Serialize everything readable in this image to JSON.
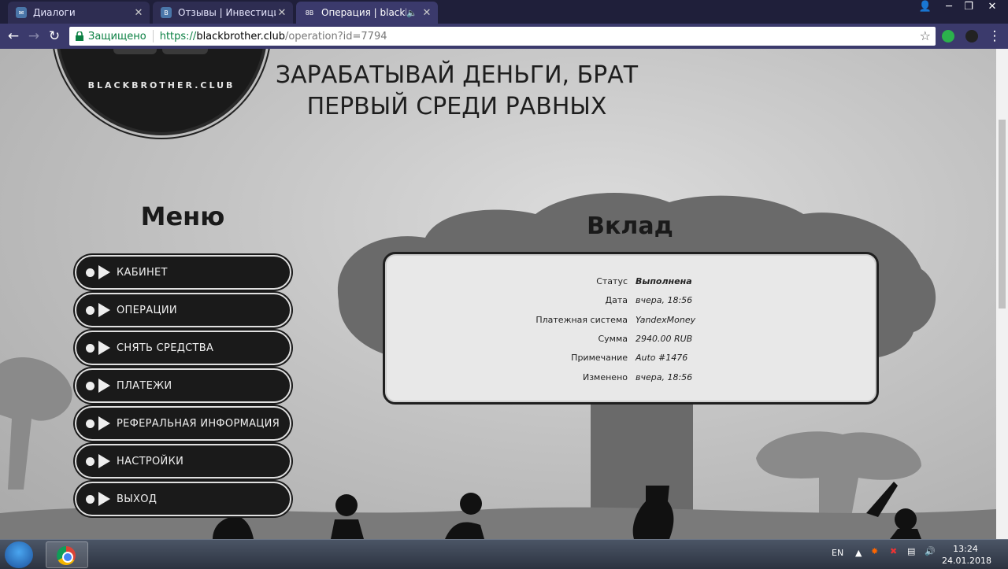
{
  "tabs": [
    {
      "title": "Диалоги",
      "active": false
    },
    {
      "title": "Отзывы | Инвестиционн",
      "active": false
    },
    {
      "title": "Операция | blackbrot",
      "active": true
    }
  ],
  "tab_favicon_text": "8B",
  "address": {
    "secure_label": "Защищено",
    "scheme": "https://",
    "host": "blackbrother.club",
    "path": "/operation?id=7794"
  },
  "site": {
    "logo_text": "BLACKBROTHER.CLUB",
    "slogan_line1": "ЗАРАБАТЫВАЙ ДЕНЬГИ, БРАТ",
    "slogan_line2": "ПЕРВЫЙ СРЕДИ РАВНЫХ"
  },
  "menu": {
    "title": "Меню",
    "items": [
      {
        "label": "КАБИНЕТ"
      },
      {
        "label": "ОПЕРАЦИИ"
      },
      {
        "label": "СНЯТЬ СРЕДСТВА"
      },
      {
        "label": "ПЛАТЕЖИ"
      },
      {
        "label": "РЕФЕРАЛЬНАЯ ИНФОРМАЦИЯ"
      },
      {
        "label": "НАСТРОЙКИ"
      },
      {
        "label": "ВЫХОД"
      }
    ]
  },
  "deposit": {
    "title": "Вклад",
    "rows": [
      {
        "key": "Статус",
        "value": "Выполнена"
      },
      {
        "key": "Дата",
        "value": "вчера, 18:56"
      },
      {
        "key": "Платежная система",
        "value": "YandexMoney"
      },
      {
        "key": "Сумма",
        "value": "2940.00 RUB"
      },
      {
        "key": "Примечание",
        "value": "Auto #1476"
      },
      {
        "key": "Изменено",
        "value": "вчера, 18:56"
      }
    ]
  },
  "taskbar": {
    "lang": "EN",
    "time": "13:24",
    "date": "24.01.2018"
  },
  "colors": {
    "chrome_frame": "#3b3a6c",
    "menu_button": "#1a1a1a",
    "secure_green": "#0b8043"
  }
}
